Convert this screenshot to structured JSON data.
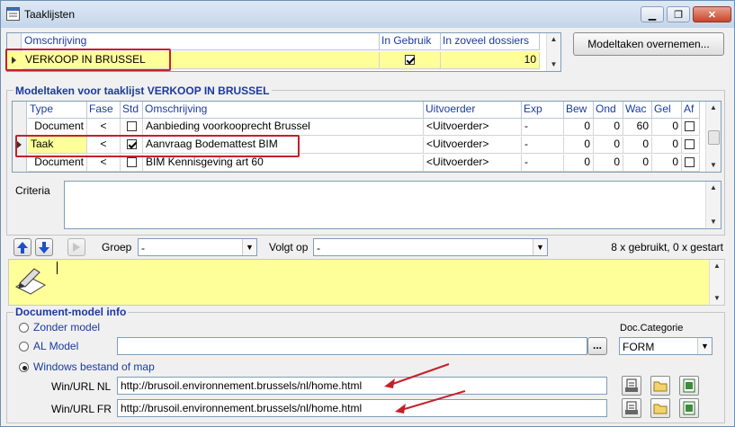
{
  "window": {
    "title": "Taaklijsten",
    "minimize": "▁",
    "restore": "❐",
    "close": "✕"
  },
  "tasklists": {
    "headers": [
      "Omschrijving",
      "In Gebruik",
      "In zoveel dossiers"
    ],
    "row": {
      "omschrijving": "VERKOOP IN BRUSSEL",
      "in_gebruik": true,
      "dossiers": "10"
    }
  },
  "btn_overnemen": "Modeltaken overnemen...",
  "modeltaken": {
    "group_label": "Modeltaken voor taaklijst VERKOOP IN BRUSSEL",
    "headers": [
      "Type",
      "Fase",
      "Std",
      "Omschrijving",
      "Uitvoerder",
      "Exp",
      "Bew",
      "Ond",
      "Wac",
      "Gel",
      "Af"
    ],
    "rows": [
      {
        "type": "Document",
        "fase": "<",
        "std": false,
        "omschrijving": "Aanbieding voorkooprecht Brussel",
        "uitvoerder": "<Uitvoerder>",
        "exp": "-",
        "bew": "0",
        "ond": "0",
        "wac": "60",
        "gel": "0",
        "af": false
      },
      {
        "type": "Taak",
        "fase": "<",
        "std": true,
        "omschrijving": "Aanvraag Bodemattest BIM",
        "uitvoerder": "<Uitvoerder>",
        "exp": "-",
        "bew": "0",
        "ond": "0",
        "wac": "0",
        "gel": "0",
        "af": false
      },
      {
        "type": "Document",
        "fase": "<",
        "std": false,
        "omschrijving": "BIM Kennisgeving art 60",
        "uitvoerder": "<Uitvoerder>",
        "exp": "-",
        "bew": "0",
        "ond": "0",
        "wac": "0",
        "gel": "0",
        "af": false
      }
    ]
  },
  "criteria": {
    "label": "Criteria",
    "value": ""
  },
  "toolbar": {
    "groep_label": "Groep",
    "groep_value": "-",
    "volgt_label": "Volgt op",
    "volgt_value": "-",
    "usage": "8 x gebruikt, 0 x gestart"
  },
  "docmodel": {
    "group_label": "Document-model info",
    "options": [
      "Zonder model",
      "AL Model",
      "Windows bestand of map"
    ],
    "selected": 2,
    "al_model_value": "",
    "browse": "...",
    "categorie_label": "Doc.Categorie",
    "categorie_value": "FORM",
    "nl_label": "Win/URL NL",
    "nl_value": "http://brusoil.environnement.brussels/nl/home.html",
    "fr_label": "Win/URL FR",
    "fr_value": "http://brusoil.environnement.brussels/nl/home.html"
  },
  "colors": {
    "row_highlight": "#ffff99",
    "annotation": "#c4202a",
    "header_text": "#1a3aa0"
  }
}
